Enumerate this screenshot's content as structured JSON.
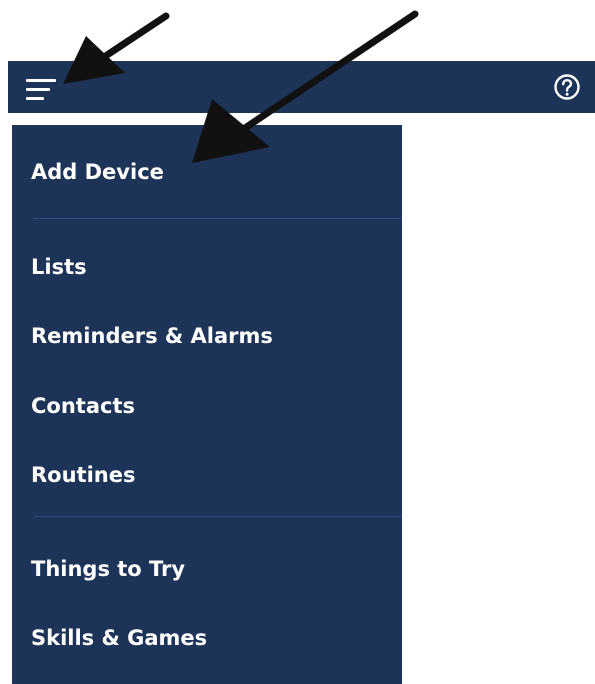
{
  "header": {
    "menu_icon": "hamburger-menu-icon",
    "help_icon": "help-question-icon"
  },
  "menu": {
    "items": [
      {
        "label": "Add Device"
      },
      {
        "label": "Lists"
      },
      {
        "label": "Reminders & Alarms"
      },
      {
        "label": "Contacts"
      },
      {
        "label": "Routines"
      },
      {
        "label": "Things to Try"
      },
      {
        "label": "Skills & Games"
      }
    ]
  },
  "annotations": {
    "arrow_icon": "pointer-arrow-icon"
  },
  "colors": {
    "bar_background": "#1d3458",
    "menu_background": "#1d3458",
    "divider": "#34497a",
    "text": "#ffffff",
    "arrow": "#111111"
  }
}
